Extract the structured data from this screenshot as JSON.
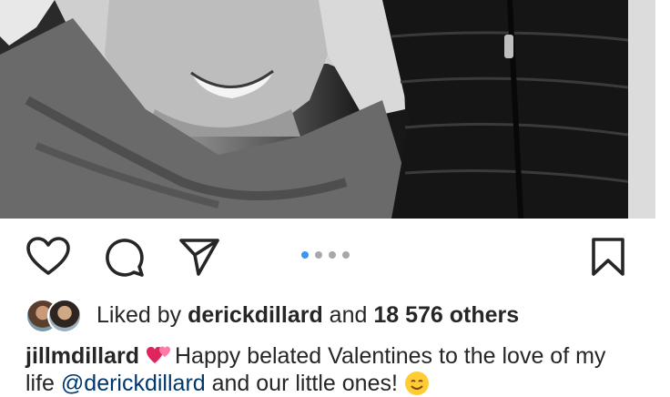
{
  "post": {
    "likes": {
      "prefix": "Liked by ",
      "user": "derickdillard",
      "middle": " and ",
      "count": "18 576 others"
    },
    "caption": {
      "username": "jillmdillard",
      "text": "Happy belated Valentines to the love of my",
      "line2_prefix": "life ",
      "mention": "@derickdillard",
      "line2_suffix": " and our little ones! "
    },
    "carousel": {
      "total": 4,
      "active_index": 0
    }
  },
  "icons": {
    "like": "heart-icon",
    "comment": "comment-icon",
    "share": "send-icon",
    "save": "bookmark-icon",
    "caption_emoji": "two-hearts-emoji",
    "smile_emoji": "smiling-face-emoji"
  },
  "colors": {
    "text": "#262626",
    "mention": "#00376b",
    "dot_active": "#3897f0",
    "dot_inactive": "#a8a8a8"
  }
}
